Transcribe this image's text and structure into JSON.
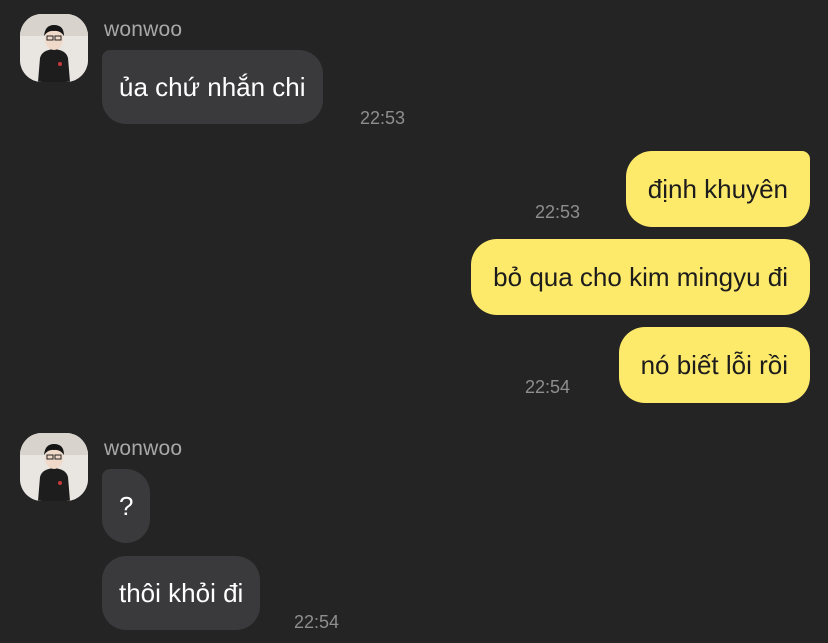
{
  "sender_name": "wonwoo",
  "messages": {
    "m1": {
      "text": "ủa chứ nhắn chi",
      "time": "22:53"
    },
    "m2": {
      "text": "định khuyên",
      "time": "22:53"
    },
    "m3": {
      "text": "bỏ qua cho kim mingyu đi"
    },
    "m4": {
      "text": "nó biết lỗi rồi",
      "time": "22:54"
    },
    "m5": {
      "text": "?"
    },
    "m6": {
      "text": "thôi khỏi đi",
      "time": "22:54"
    }
  },
  "colors": {
    "background": "#242424",
    "incoming_bubble": "#3a3a3c",
    "outgoing_bubble": "#fde96a",
    "timestamp": "#8e8e8e",
    "sender_name": "#a8a8a8"
  }
}
